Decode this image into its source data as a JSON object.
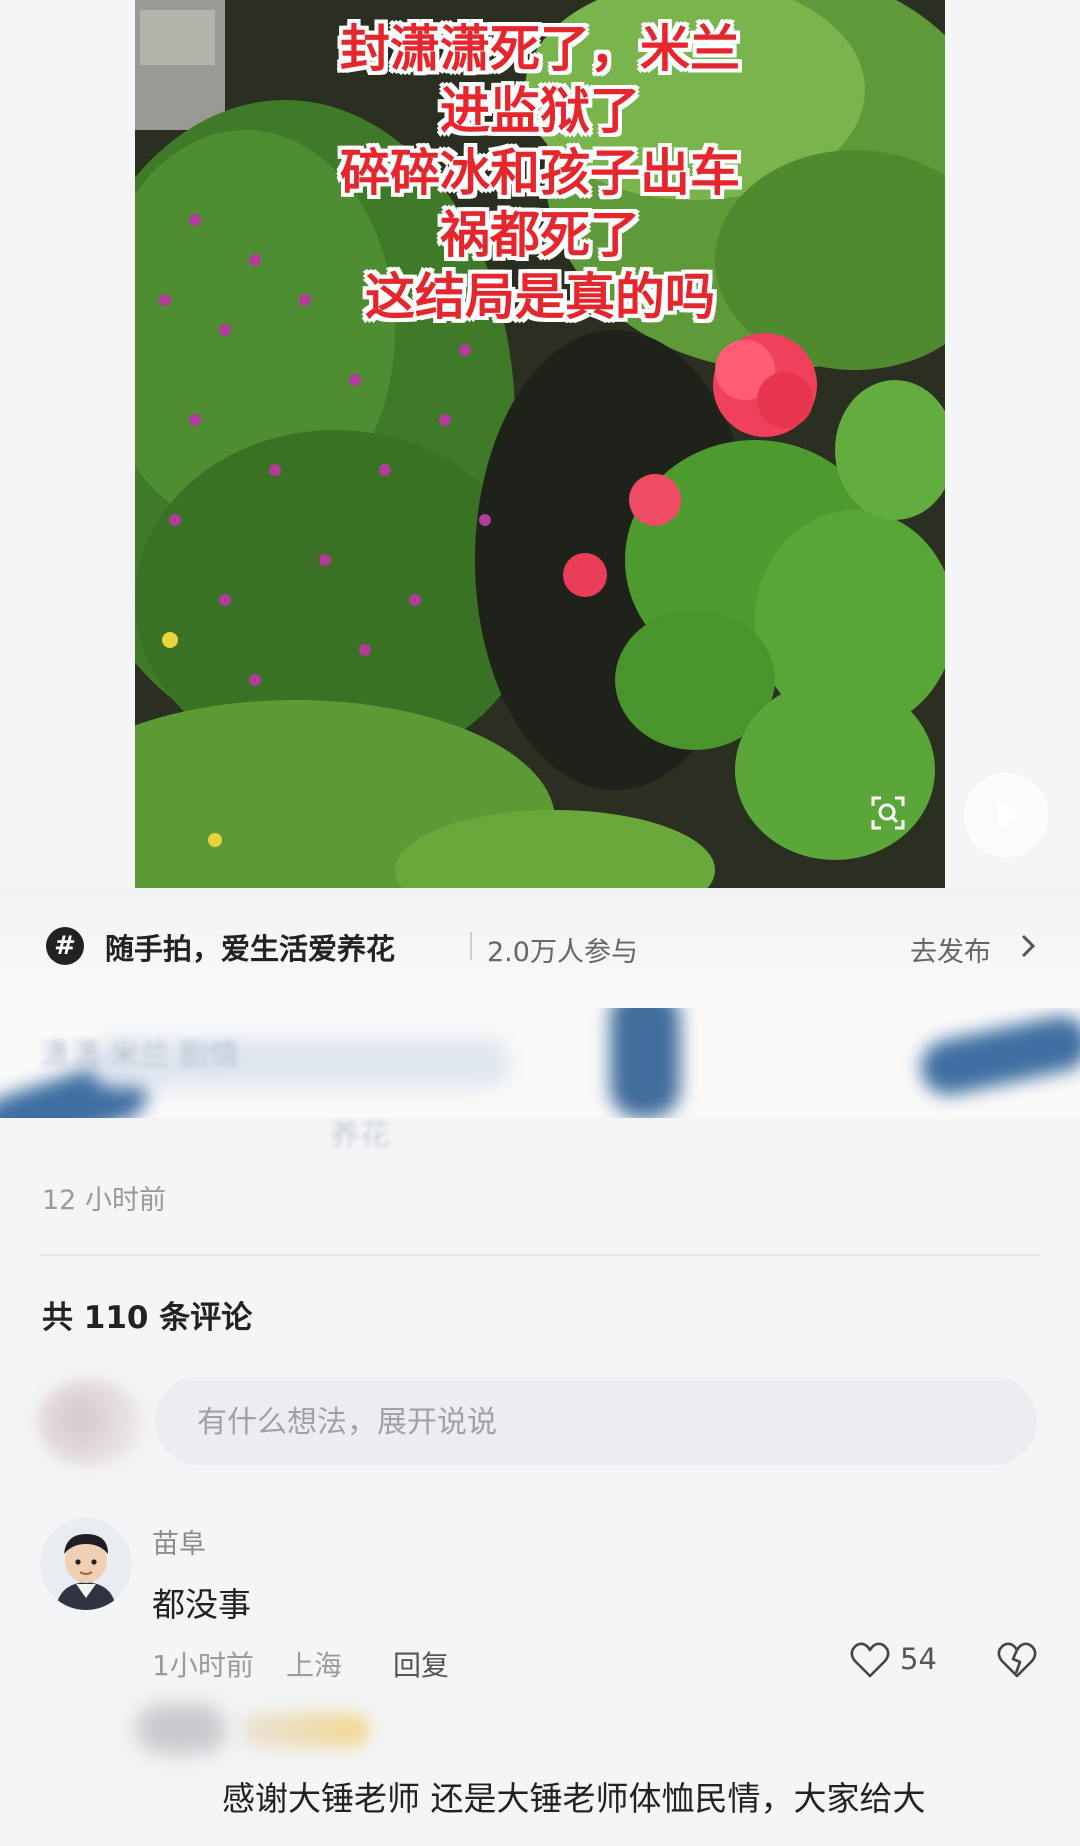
{
  "post": {
    "overlay_lines": [
      "封潇潇死了，米兰",
      "进监狱了",
      "碎碎冰和孩子出车",
      "祸都死了",
      "这结局是真的吗"
    ],
    "lens_icon": "image-search-icon",
    "play_icon": "play-icon"
  },
  "topic": {
    "icon": "hashtag-icon",
    "name": "随手拍，爱生活爱养花",
    "participants": "2.0万人参与",
    "action": "去发布",
    "action_icon": "chevron-right-icon"
  },
  "description": {
    "blurred_line1": "潇潇 米兰 剧情",
    "blurred_line2": "养花",
    "time": "12 小时前"
  },
  "comments": {
    "count_label": "共 110 条评论",
    "input_placeholder": "有什么想法，展开说说",
    "items": [
      {
        "username": "苗阜",
        "text": "都没事",
        "time": "1小时前",
        "location": "上海",
        "reply_label": "回复",
        "likes": "54"
      }
    ],
    "reply_preview": "感谢大锤老师 还是大锤老师体恤民情，大家给大"
  },
  "colors": {
    "overlay_text": "#e5262c",
    "background": "#f4f5f7",
    "secondary_text": "#9b9b9b"
  }
}
